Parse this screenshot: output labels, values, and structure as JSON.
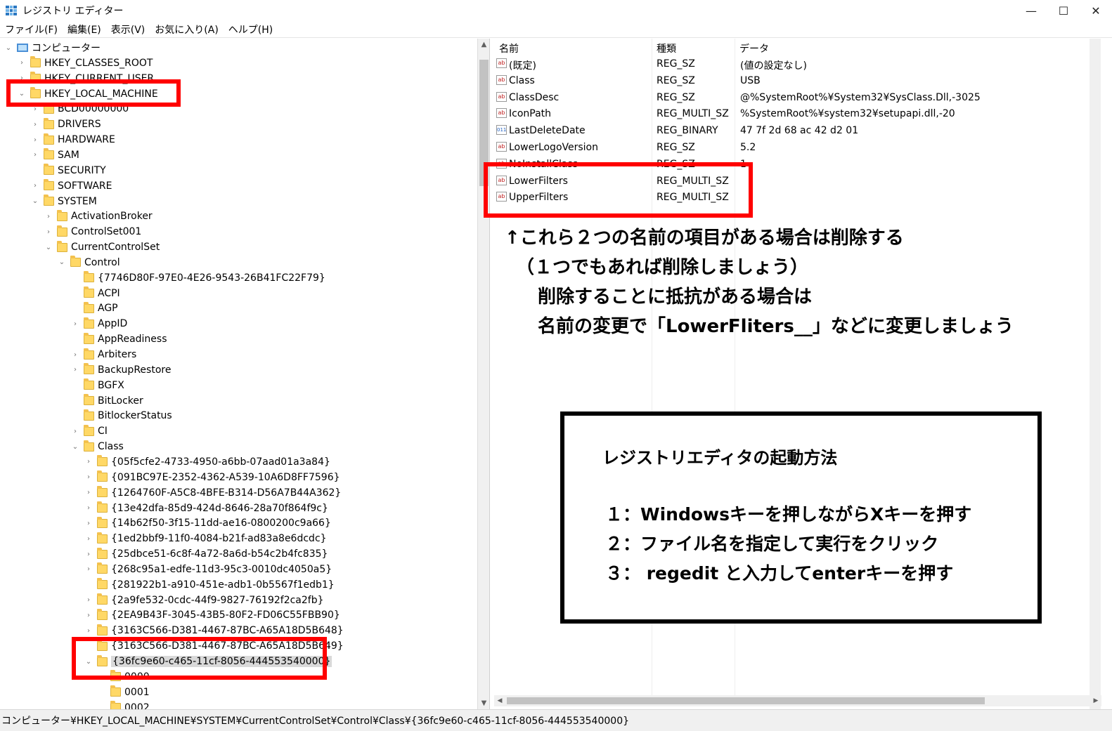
{
  "window": {
    "title": "レジストリ エディター",
    "minimize": "—",
    "maximize": "☐",
    "close": "✕"
  },
  "menu": [
    "ファイル(F)",
    "編集(E)",
    "表示(V)",
    "お気に入り(A)",
    "ヘルプ(H)"
  ],
  "tree": [
    {
      "label": "コンピューター",
      "level": 0,
      "expander": "expanded",
      "icon": "computer-icon"
    },
    {
      "label": "HKEY_CLASSES_ROOT",
      "level": 1,
      "expander": "collapsed"
    },
    {
      "label": "HKEY_CURRENT_USER",
      "level": 1,
      "expander": "collapsed"
    },
    {
      "label": "HKEY_LOCAL_MACHINE",
      "level": 1,
      "expander": "expanded"
    },
    {
      "label": "BCD00000000",
      "level": 2,
      "expander": "collapsed"
    },
    {
      "label": "DRIVERS",
      "level": 2,
      "expander": "collapsed"
    },
    {
      "label": "HARDWARE",
      "level": 2,
      "expander": "collapsed"
    },
    {
      "label": "SAM",
      "level": 2,
      "expander": "collapsed"
    },
    {
      "label": "SECURITY",
      "level": 2,
      "expander": "none"
    },
    {
      "label": "SOFTWARE",
      "level": 2,
      "expander": "collapsed"
    },
    {
      "label": "SYSTEM",
      "level": 2,
      "expander": "expanded"
    },
    {
      "label": "ActivationBroker",
      "level": 3,
      "expander": "collapsed"
    },
    {
      "label": "ControlSet001",
      "level": 3,
      "expander": "collapsed"
    },
    {
      "label": "CurrentControlSet",
      "level": 3,
      "expander": "expanded"
    },
    {
      "label": "Control",
      "level": 4,
      "expander": "expanded"
    },
    {
      "label": "{7746D80F-97E0-4E26-9543-26B41FC22F79}",
      "level": 5,
      "expander": "none"
    },
    {
      "label": "ACPI",
      "level": 5,
      "expander": "none"
    },
    {
      "label": "AGP",
      "level": 5,
      "expander": "none"
    },
    {
      "label": "AppID",
      "level": 5,
      "expander": "collapsed"
    },
    {
      "label": "AppReadiness",
      "level": 5,
      "expander": "none"
    },
    {
      "label": "Arbiters",
      "level": 5,
      "expander": "collapsed"
    },
    {
      "label": "BackupRestore",
      "level": 5,
      "expander": "collapsed"
    },
    {
      "label": "BGFX",
      "level": 5,
      "expander": "none"
    },
    {
      "label": "BitLocker",
      "level": 5,
      "expander": "none"
    },
    {
      "label": "BitlockerStatus",
      "level": 5,
      "expander": "none"
    },
    {
      "label": "CI",
      "level": 5,
      "expander": "collapsed"
    },
    {
      "label": "Class",
      "level": 5,
      "expander": "expanded"
    },
    {
      "label": "{05f5cfe2-4733-4950-a6bb-07aad01a3a84}",
      "level": 6,
      "expander": "collapsed"
    },
    {
      "label": "{091BC97E-2352-4362-A539-10A6D8FF7596}",
      "level": 6,
      "expander": "collapsed"
    },
    {
      "label": "{1264760F-A5C8-4BFE-B314-D56A7B44A362}",
      "level": 6,
      "expander": "collapsed"
    },
    {
      "label": "{13e42dfa-85d9-424d-8646-28a70f864f9c}",
      "level": 6,
      "expander": "collapsed"
    },
    {
      "label": "{14b62f50-3f15-11dd-ae16-0800200c9a66}",
      "level": 6,
      "expander": "collapsed"
    },
    {
      "label": "{1ed2bbf9-11f0-4084-b21f-ad83a8e6dcdc}",
      "level": 6,
      "expander": "collapsed"
    },
    {
      "label": "{25dbce51-6c8f-4a72-8a6d-b54c2b4fc835}",
      "level": 6,
      "expander": "collapsed"
    },
    {
      "label": "{268c95a1-edfe-11d3-95c3-0010dc4050a5}",
      "level": 6,
      "expander": "collapsed"
    },
    {
      "label": "{281922b1-a910-451e-adb1-0b5567f1edb1}",
      "level": 6,
      "expander": "none"
    },
    {
      "label": "{2a9fe532-0cdc-44f9-9827-76192f2ca2fb}",
      "level": 6,
      "expander": "collapsed"
    },
    {
      "label": "{2EA9B43F-3045-43B5-80F2-FD06C55FBB90}",
      "level": 6,
      "expander": "collapsed"
    },
    {
      "label": "{3163C566-D381-4467-87BC-A65A18D5B648}",
      "level": 6,
      "expander": "collapsed"
    },
    {
      "label": "{3163C566-D381-4467-87BC-A65A18D5B649}",
      "level": 6,
      "expander": "none"
    },
    {
      "label": "{36fc9e60-c465-11cf-8056-444553540000}",
      "level": 6,
      "expander": "expanded",
      "selected": true
    },
    {
      "label": "0000",
      "level": 7,
      "expander": "none"
    },
    {
      "label": "0001",
      "level": 7,
      "expander": "none"
    },
    {
      "label": "0002",
      "level": 7,
      "expander": "none"
    }
  ],
  "columns": {
    "name": "名前",
    "type": "種類",
    "data": "データ"
  },
  "values": [
    {
      "icon": "string",
      "name": "(既定)",
      "type": "REG_SZ",
      "data": "(値の設定なし)"
    },
    {
      "icon": "string",
      "name": "Class",
      "type": "REG_SZ",
      "data": "USB"
    },
    {
      "icon": "string",
      "name": "ClassDesc",
      "type": "REG_SZ",
      "data": "@%SystemRoot%¥System32¥SysClass.Dll,-3025"
    },
    {
      "icon": "string",
      "name": "IconPath",
      "type": "REG_MULTI_SZ",
      "data": "%SystemRoot%¥system32¥setupapi.dll,-20"
    },
    {
      "icon": "binary",
      "name": "LastDeleteDate",
      "type": "REG_BINARY",
      "data": "47 7f 2d 68 ac 42 d2 01"
    },
    {
      "icon": "string",
      "name": "LowerLogoVersion",
      "type": "REG_SZ",
      "data": "5.2"
    },
    {
      "icon": "string",
      "name": "NoInstallClass",
      "type": "REG_SZ",
      "data": "1"
    },
    {
      "icon": "string",
      "name": "LowerFilters",
      "type": "REG_MULTI_SZ",
      "data": ""
    },
    {
      "icon": "string",
      "name": "UpperFilters",
      "type": "REG_MULTI_SZ",
      "data": ""
    }
  ],
  "icon_glyphs": {
    "string": "ab",
    "binary": "011"
  },
  "annotation": {
    "line1": "↑これら２つの名前の項目がある場合は削除する",
    "line2": "（１つでもあれば削除しましょう）",
    "line3": "削除することに抵抗がある場合は",
    "line4": "名前の変更で「LowerFliters__」などに変更しましょう"
  },
  "info_box": {
    "title": "レジストリエディタの起動方法",
    "steps": [
      "１：Windowsキーを押しながらXキーを押す",
      "２：ファイル名を指定して実行をクリック",
      "３： regedit と入力してenterキーを押す"
    ]
  },
  "status_path": "コンピューター¥HKEY_LOCAL_MACHINE¥SYSTEM¥CurrentControlSet¥Control¥Class¥{36fc9e60-c465-11cf-8056-444553540000}",
  "colors": {
    "highlight": "#ff0000",
    "folder": "#ffd866",
    "selection": "#d9d9d9"
  }
}
